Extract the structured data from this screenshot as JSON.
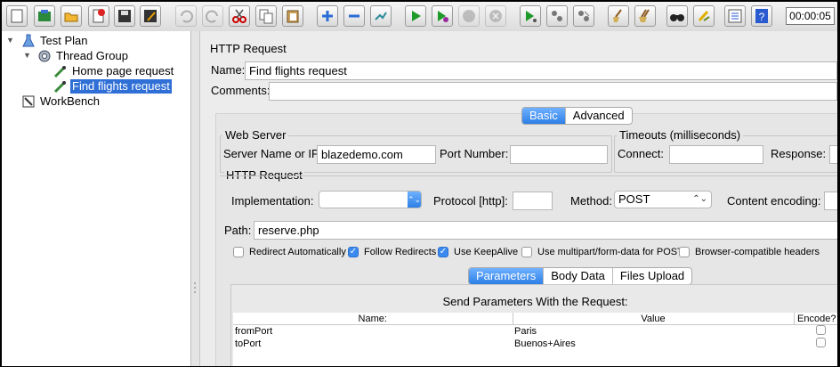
{
  "toolbar": {
    "buttons": [
      {
        "name": "new-icon"
      },
      {
        "name": "templates-icon"
      },
      {
        "name": "open-icon"
      },
      {
        "name": "close-icon"
      },
      {
        "name": "save-icon"
      },
      {
        "name": "save-as-icon"
      },
      {
        "name": "undo-icon"
      },
      {
        "name": "redo-icon"
      },
      {
        "name": "cut-icon"
      },
      {
        "name": "copy-icon"
      },
      {
        "name": "paste-icon"
      },
      {
        "name": "expand-icon"
      },
      {
        "name": "collapse-icon"
      },
      {
        "name": "toggle-icon"
      },
      {
        "name": "start-icon"
      },
      {
        "name": "start-no-pauses-icon"
      },
      {
        "name": "stop-icon"
      },
      {
        "name": "shutdown-icon"
      },
      {
        "name": "remote-start-icon"
      },
      {
        "name": "remote-stop-icon"
      },
      {
        "name": "remote-shutdown-icon"
      },
      {
        "name": "clear-icon"
      },
      {
        "name": "clear-all-icon"
      },
      {
        "name": "search-icon"
      },
      {
        "name": "reset-search-icon"
      },
      {
        "name": "function-helper-icon"
      },
      {
        "name": "help-icon"
      }
    ],
    "timer": "00:00:05"
  },
  "tree": {
    "items": [
      {
        "label": "Test Plan"
      },
      {
        "label": "Thread Group"
      },
      {
        "label": "Home page request"
      },
      {
        "label": "Find flights request"
      },
      {
        "label": "WorkBench"
      }
    ]
  },
  "panel": {
    "title": "HTTP Request",
    "name_label": "Name:",
    "name_value": "Find flights request",
    "comments_label": "Comments:",
    "comments_value": "",
    "tabs": [
      "Basic",
      "Advanced"
    ],
    "web_server": {
      "title": "Web Server",
      "server_label": "Server Name or IP:",
      "server_value": "blazedemo.com",
      "port_label": "Port Number:",
      "port_value": ""
    },
    "timeouts": {
      "title": "Timeouts (milliseconds)",
      "connect_label": "Connect:",
      "response_label": "Response:"
    },
    "http_request": {
      "title": "HTTP Request",
      "implementation_label": "Implementation:",
      "implementation_value": "",
      "protocol_label": "Protocol [http]:",
      "protocol_value": "",
      "method_label": "Method:",
      "method_value": "POST",
      "encoding_label": "Content encoding:",
      "path_label": "Path:",
      "path_value": "reserve.php"
    },
    "options": [
      {
        "label": "Redirect Automatically",
        "checked": false
      },
      {
        "label": "Follow Redirects",
        "checked": true
      },
      {
        "label": "Use KeepAlive",
        "checked": true
      },
      {
        "label": "Use multipart/form-data for POST",
        "checked": false
      },
      {
        "label": "Browser-compatible headers",
        "checked": false
      }
    ],
    "param_tabs": [
      "Parameters",
      "Body Data",
      "Files Upload"
    ],
    "params_title": "Send Parameters With the Request:",
    "columns": [
      "Name:",
      "Value",
      "Encode?"
    ],
    "rows": [
      {
        "name": "fromPort",
        "value": "Paris",
        "encode": false
      },
      {
        "name": "toPort",
        "value": "Buenos+Aires",
        "encode": false
      }
    ]
  }
}
